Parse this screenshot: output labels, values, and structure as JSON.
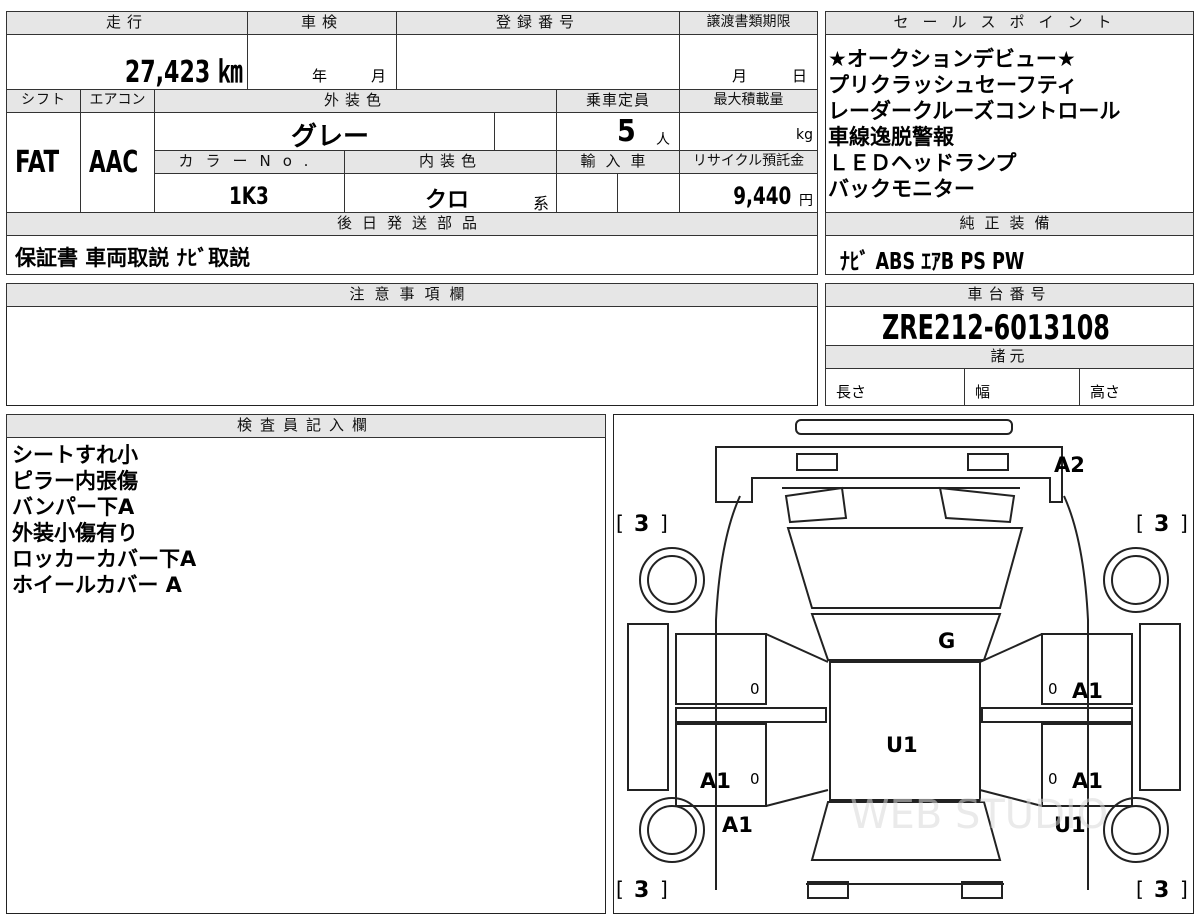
{
  "top": {
    "mileage_label": "走行",
    "mileage_value": "27,423 ㎞",
    "inspection_label": "車検",
    "inspection_year_unit": "年",
    "inspection_month_unit": "月",
    "registration_label": "登録番号",
    "transfer_deadline_label": "譲渡書類期限",
    "transfer_month_unit": "月",
    "transfer_day_unit": "日"
  },
  "row2": {
    "shift_label": "シフト",
    "shift_value": "FAT",
    "ac_label": "エアコン",
    "ac_value": "AAC",
    "exterior_color_label": "外装色",
    "exterior_color_value": "グレー",
    "capacity_label": "乗車定員",
    "capacity_value": "5",
    "capacity_unit": "人",
    "max_load_label": "最大積載量",
    "max_load_unit": "kg",
    "color_no_label": "カラーNo.",
    "color_no_value": "1K3",
    "interior_color_label": "内装色",
    "interior_color_value": "クロ",
    "interior_color_suffix": "系",
    "import_label": "輸入車",
    "recycle_label": "リサイクル預託金",
    "recycle_value": "9,440",
    "recycle_unit": "円"
  },
  "shipping": {
    "label": "後日発送部品",
    "value": "保証書 車両取説 ﾅﾋﾞ取説"
  },
  "sales_points": {
    "label": "セールスポイント",
    "items": [
      "★オークションデビュー★",
      "プリクラッシュセーフティ",
      "レーダークルーズコントロール",
      "車線逸脱警報",
      "ＬＥＤヘッドランプ",
      "バックモニター"
    ]
  },
  "equipment": {
    "label": "純正装備",
    "value": "ﾅﾋﾞ ABS ｴｱB PS PW"
  },
  "notes": {
    "label": "注意事項欄",
    "value": ""
  },
  "chassis": {
    "label": "車台番号",
    "value": "ZRE212-6013108"
  },
  "specs": {
    "label": "諸元",
    "length_label": "長さ",
    "width_label": "幅",
    "height_label": "高さ"
  },
  "inspector": {
    "label": "検査員記入欄",
    "lines": [
      "シートすれ小",
      "ピラー内張傷",
      "バンパー下A",
      "外装小傷有り",
      "ロッカーカバー下A",
      "ホイールカバー A"
    ]
  },
  "diagram": {
    "tire_tl": "3",
    "tire_tr": "3",
    "tire_bl": "3",
    "tire_br": "3",
    "marks": {
      "front_bumper": "A2",
      "windshield": "G",
      "roof": "U1",
      "right_front_door": "A1",
      "right_rear_door": "A1",
      "left_rear_door": "A1",
      "left_rear_fender": "A1",
      "right_rear_fender": "U1"
    },
    "zero_marks": [
      "0",
      "0",
      "0",
      "0"
    ],
    "watermark": "WEB STUDIO"
  }
}
